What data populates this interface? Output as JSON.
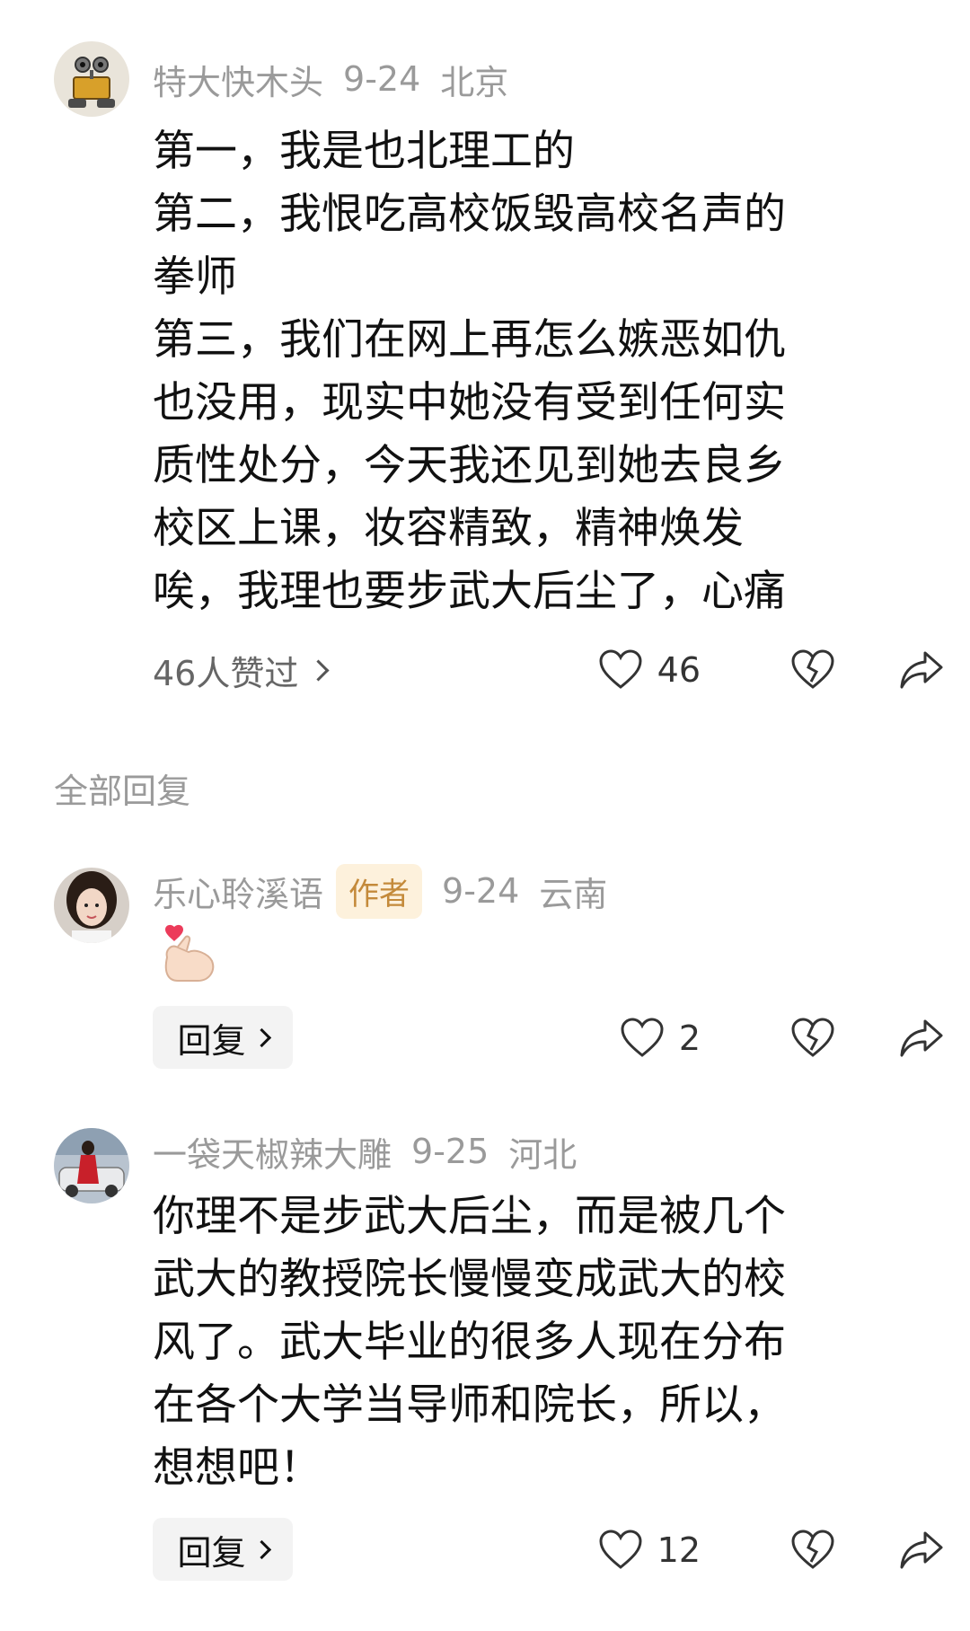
{
  "comment1": {
    "username": "特大快木头",
    "date": "9-24",
    "location": "北京",
    "lines": [
      "第一，我是也北理工的",
      "第二，我恨吃高校饭毁高校名声的",
      "拳师",
      "第三，我们在网上再怎么嫉恶如仇",
      "也没用，现实中她没有受到任何实",
      "质性处分，今天我还见到她去良乡",
      "校区上课，妆容精致，精神焕发",
      "唉，我理也要步武大后尘了，心痛"
    ],
    "likes_link": "46人赞过",
    "like_count": "46"
  },
  "section": {
    "title": "全部回复"
  },
  "reply1": {
    "username": "乐心聆溪语",
    "badge": "作者",
    "date": "9-24",
    "location": "云南",
    "emoji": "finger-heart",
    "reply_label": "回复",
    "like_count": "2"
  },
  "reply2": {
    "username": "一袋天椒辣大雕",
    "date": "9-25",
    "location": "河北",
    "lines": [
      "你理不是步武大后尘，而是被几个",
      "武大的教授院长慢慢变成武大的校",
      "风了。武大毕业的很多人现在分布",
      "在各个大学当导师和院长，所以，",
      "想想吧！"
    ],
    "reply_label": "回复",
    "like_count": "12"
  },
  "colors": {
    "meta": "#9a9a9a",
    "badge_bg": "#fdf1dc",
    "badge_text": "#c48a3a"
  }
}
